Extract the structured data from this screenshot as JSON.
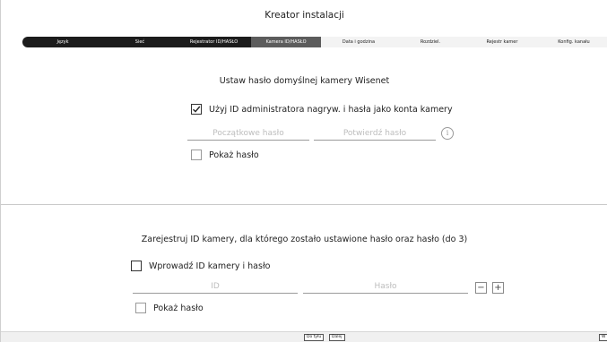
{
  "window": {
    "title": "Kreator instalacji"
  },
  "steps": [
    {
      "label": "Język",
      "state": "done"
    },
    {
      "label": "Sieć",
      "state": "done"
    },
    {
      "label": "Rejestrator ID/HASŁO",
      "state": "done"
    },
    {
      "label": "Kamera ID/HASŁO",
      "state": "current"
    },
    {
      "label": "Data i godzina",
      "state": "pending"
    },
    {
      "label": "Rozdziel.",
      "state": "pending"
    },
    {
      "label": "Rejestr kamer",
      "state": "pending"
    },
    {
      "label": "Konfig. kanału",
      "state": "pending"
    }
  ],
  "default_password": {
    "heading": "Ustaw hasło domyślnej kamery Wisenet",
    "use_admin_label": "Użyj ID administratora nagryw. i hasła jako konta kamery",
    "use_admin_checked": true,
    "initial_password_placeholder": "Początkowe hasło",
    "confirm_password_placeholder": "Potwierdź hasło",
    "info_icon": "info-icon",
    "show_password_label": "Pokaż hasło",
    "show_password_checked": false
  },
  "register": {
    "heading": "Zarejestruj ID kamery, dla którego zostało ustawione hasło oraz hasło (do 3)",
    "enter_label": "Wprowadź ID kamery i hasło",
    "enter_checked": false,
    "id_placeholder": "ID",
    "password_placeholder": "Hasło",
    "minus_symbol": "−",
    "plus_symbol": "+",
    "show_password_label": "Pokaż hasło",
    "show_password_checked": false
  },
  "footer": {
    "back_label": "Do tyłu",
    "next_label": "Dalej",
    "right_label": "W"
  },
  "colors": {
    "step_done": "#1c1c1c",
    "step_current": "#5c5c5c",
    "placeholder": "#bdbdbd"
  }
}
